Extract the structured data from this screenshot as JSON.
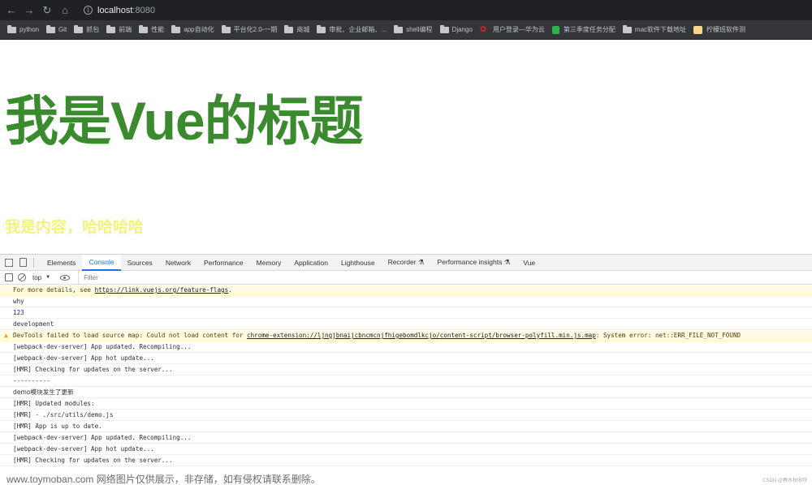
{
  "browser": {
    "url_host": "localhost",
    "url_port": ":8080",
    "bookmarks": [
      {
        "label": "python",
        "icon": "folder"
      },
      {
        "label": "Git",
        "icon": "folder"
      },
      {
        "label": "抓包",
        "icon": "folder"
      },
      {
        "label": "前端",
        "icon": "folder"
      },
      {
        "label": "性能",
        "icon": "folder"
      },
      {
        "label": "app自动化",
        "icon": "folder"
      },
      {
        "label": "平台化2.0-一期",
        "icon": "folder"
      },
      {
        "label": "商城",
        "icon": "folder"
      },
      {
        "label": "审批、企业邮箱、...",
        "icon": "folder"
      },
      {
        "label": "shell编程",
        "icon": "folder"
      },
      {
        "label": "Django",
        "icon": "folder"
      },
      {
        "label": "用户登录—华为云",
        "icon": "huawei"
      },
      {
        "label": "第三季度任务分配",
        "icon": "sheet"
      },
      {
        "label": "mac软件下载地址",
        "icon": "folder"
      },
      {
        "label": "柠檬班软件测",
        "icon": "lemon"
      }
    ]
  },
  "page": {
    "title": "我是Vue的标题",
    "content": "我是内容，哈哈哈哈"
  },
  "devtools": {
    "tabs": [
      "Elements",
      "Console",
      "Sources",
      "Network",
      "Performance",
      "Memory",
      "Application",
      "Lighthouse",
      "Recorder ⚗",
      "Performance insights ⚗",
      "Vue"
    ],
    "active_tab": "Console",
    "context": "top",
    "filter_placeholder": "Filter"
  },
  "console": {
    "line0_prefix": "For more details, see ",
    "line0_link": "https://link.vuejs.org/feature-flags",
    "line0_suffix": ".",
    "line1": "why",
    "line2": "123",
    "line3": "development",
    "line4_prefix": "DevTools failed to load source map: Could not load content for ",
    "line4_link": "chrome-extension://ljngjbnaijcbncmcnjfhigebomdlkcjo/content-script/browser-polyfill.min.js.map",
    "line4_suffix": ": System error: net::ERR_FILE_NOT_FOUND",
    "line5": "[webpack-dev-server] App updated. Recompiling...",
    "line6": "[webpack-dev-server] App hot update...",
    "line7": "[HMR] Checking for updates on the server...",
    "line8": "----------",
    "line9": "demo模块发生了更新",
    "line10": "[HMR] Updated modules:",
    "line11": "[HMR]  - ./src/utils/demo.js",
    "line12": "[HMR] App is up to date.",
    "line13": "[webpack-dev-server] App updated. Recompiling...",
    "line14": "[webpack-dev-server] App hot update...",
    "line15": "[HMR] Checking for updates on the server..."
  },
  "watermark": "www.toymoban.com 网络图片仅供展示，非存储，如有侵权请联系删除。",
  "credit": "CSDN @春水秋收呀"
}
